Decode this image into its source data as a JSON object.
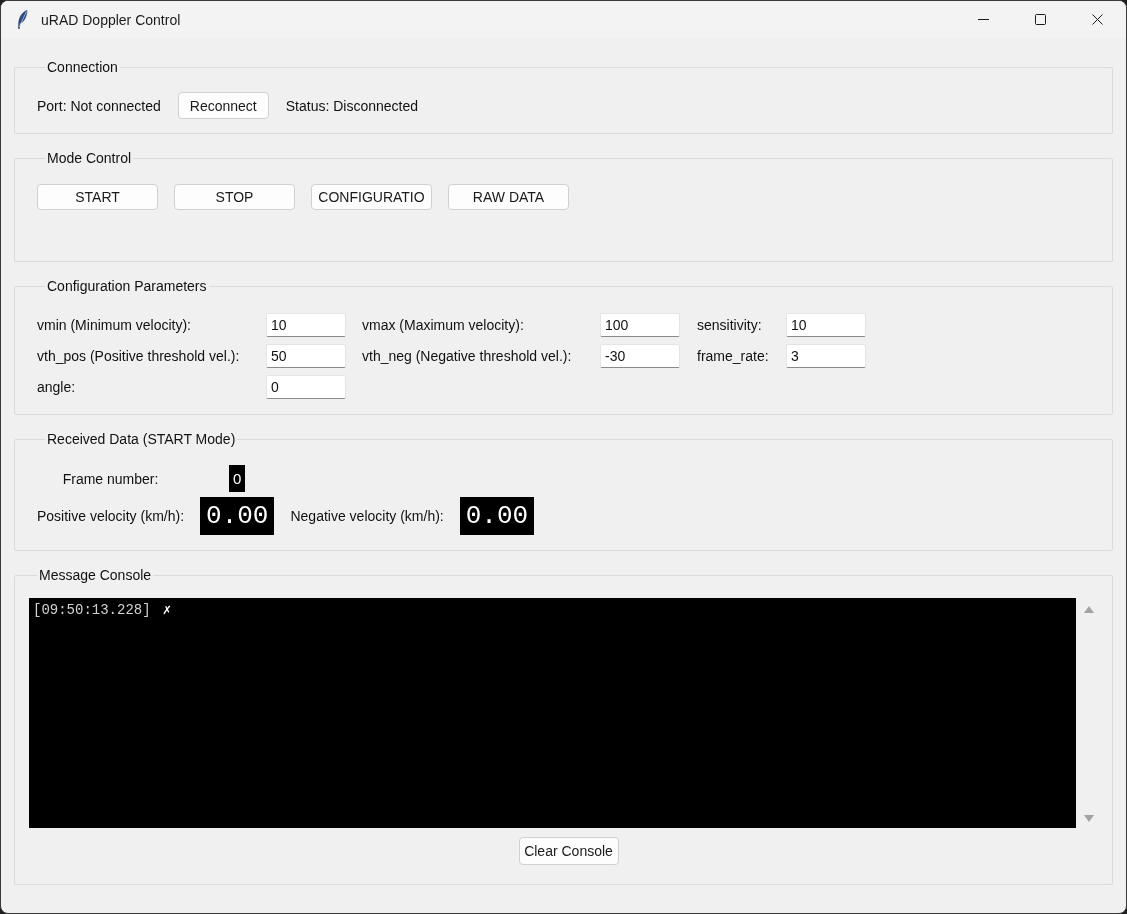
{
  "window": {
    "title": "uRAD Doppler Control"
  },
  "connection": {
    "title": "Connection",
    "port_label": "Port: Not connected",
    "reconnect_button": "Reconnect",
    "status_label": "Status: Disconnected"
  },
  "mode_control": {
    "title": "Mode Control",
    "buttons": [
      "START",
      "STOP",
      "CONFIGURATIO",
      "RAW DATA"
    ]
  },
  "configuration_parameters": {
    "title": "Configuration Parameters",
    "fields": [
      {
        "label": "vmin (Minimum velocity):",
        "value": "10"
      },
      {
        "label": "vmax (Maximum velocity):",
        "value": "100"
      },
      {
        "label": "sensitivity:",
        "value": "10"
      },
      {
        "label": "vth_pos (Positive threshold vel.):",
        "value": "50"
      },
      {
        "label": "vth_neg (Negative threshold vel.):",
        "value": "-30"
      },
      {
        "label": "frame_rate:",
        "value": "3"
      },
      {
        "label": "angle:",
        "value": "0"
      }
    ]
  },
  "received_data": {
    "title": "Received Data (START Mode)",
    "frame_number": {
      "label": "Frame number:",
      "value": "0"
    },
    "positive_velocity": {
      "label": "Positive velocity (km/h):",
      "value": "0.00"
    },
    "negative_velocity": {
      "label": "Negative velocity (km/h):",
      "value": "0.00"
    }
  },
  "message_console": {
    "title": "Message Console",
    "lines": [
      {
        "timestamp": "[09:50:13.228]",
        "message": "✗"
      }
    ],
    "clear_button": "Clear Console"
  }
}
